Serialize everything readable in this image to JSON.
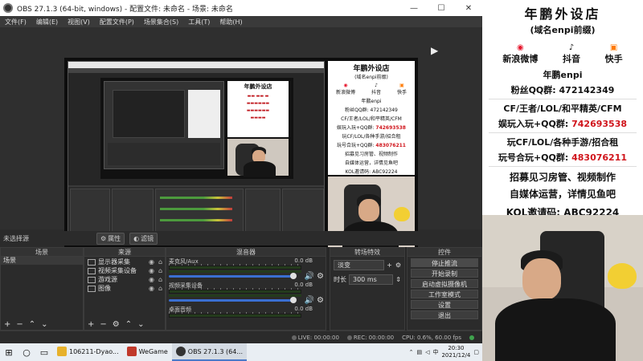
{
  "obs": {
    "title": "OBS 27.1.3 (64-bit, windows) - 配置文件: 未命名 - 场景: 未命名",
    "menu": [
      "文件(F)",
      "编辑(E)",
      "视图(V)",
      "配置文件(P)",
      "场景集合(S)",
      "工具(T)",
      "帮助(H)"
    ],
    "no_source_selected": "未选择源",
    "properties_label": "属性",
    "filters_label": "滤镜",
    "docks": {
      "scenes": {
        "title": "场景",
        "items": [
          "场景"
        ]
      },
      "sources": {
        "title": "来源",
        "items": [
          {
            "label": "显示器采集",
            "icon": "monitor-icon"
          },
          {
            "label": "视频采集设备",
            "icon": "camera-icon"
          },
          {
            "label": "游戏源",
            "icon": "gamepad-icon"
          },
          {
            "label": "图像",
            "icon": "image-icon"
          }
        ]
      },
      "mixer": {
        "title": "混音器",
        "channels": [
          {
            "name": "麦克风/Aux",
            "db": "0.0 dB",
            "level": 1.0
          },
          {
            "name": "视频采集设备",
            "db": "0.0 dB",
            "level": 1.0
          },
          {
            "name": "桌面音频",
            "db": "0.0 dB",
            "level": 1.0
          }
        ]
      },
      "transitions": {
        "title": "转场特效",
        "type": "淡变",
        "duration_label": "时长",
        "duration": "300 ms"
      },
      "controls": {
        "title": "控件",
        "buttons": [
          "停止推流",
          "开始录制",
          "启动虚拟摄像机",
          "工作室模式",
          "设置",
          "退出"
        ]
      }
    },
    "status": {
      "live": "LIVE: 00:00:00",
      "rec": "REC: 00:00:00",
      "cpu": "CPU: 0.6%, 60.00 fps"
    }
  },
  "taskbar": {
    "apps": [
      {
        "label": "106211-Dyao...",
        "color": "#e7b12b",
        "icon": "app-go-icon"
      },
      {
        "label": "WeGame",
        "color": "#c0392b",
        "icon": "wegame-icon"
      },
      {
        "label": "OBS 27.1.3 (64...",
        "color": "#333333",
        "icon": "obs-icon",
        "active": true
      }
    ],
    "tray": {
      "time": "20:30",
      "date": "2021/12/4",
      "ime": "中"
    }
  },
  "ad": {
    "title": "年鹏外设店",
    "subtitle": "(域名enpi前缀)",
    "socials": [
      {
        "label": "新浪微博",
        "icon": "weibo-icon",
        "color": "#e6162d"
      },
      {
        "label": "抖音",
        "icon": "douyin-icon",
        "color": "#111111"
      },
      {
        "label": "快手",
        "icon": "kuaishou-icon",
        "color": "#ff7a00"
      }
    ],
    "name_line": "年鹏enpi",
    "fans_line": "粉丝QQ群: 472142349",
    "group1_label": "CF/王者/LOL/和平精英/CFM",
    "group1_sub": "娱玩入玩+QQ群: ",
    "group1_num": "742693538",
    "group2_label": "玩CF/LOL/各种手游/招合租",
    "group2_sub": "玩号合玩+QQ群: ",
    "group2_num": "483076211",
    "recruit1": "招募见习房管、视频制作",
    "recruit2": "自媒体运营，详情见鱼吧",
    "kol": "KOL邀请码: ABC92224"
  },
  "colors": {
    "accent_red": "#d0141b",
    "obs_bg": "#2b2b2b",
    "taskbar": "#e9eef3"
  }
}
